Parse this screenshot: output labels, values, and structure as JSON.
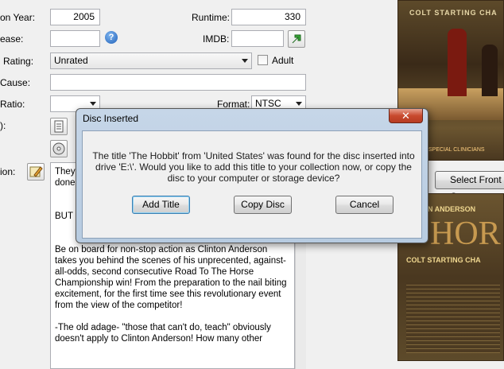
{
  "form": {
    "year_label": "on Year:",
    "year_value": "2005",
    "runtime_label": "Runtime:",
    "runtime_value": "330",
    "release_label": "ease:",
    "imdb_label": "IMDB:",
    "rating_label": "Rating:",
    "rating_value": "Unrated",
    "adult_label": "Adult",
    "cause_label": "Cause:",
    "ratio_label": "Ratio:",
    "format_label": "Format:",
    "format_value": "NTSC",
    "row_label_paren": "):",
    "description_label": "ion:"
  },
  "description": {
    "para1": "They",
    "para1b": "done",
    "para2": "BUT T",
    "para3": "Be on board for non-stop action as Clinton Anderson takes you behind the scenes of his unprecented, against-all-odds, second consecutive Road To The Horse Championship win! From the preparation to the nail biting excitement, for the first time see this revolutionary event from the view of the competitor!",
    "para4": "-The old adage- \"those that can't do, teach\" obviously doesn't apply to Clinton Anderson!  How many other"
  },
  "right_panel": {
    "select_front_label": "Select Front C",
    "cover_top_text": "COLT STARTING CHA",
    "cover_bottom_title": "ON ANDERSON",
    "cover_bottom_sub": "COLT STARTING CHA",
    "cover_tagline": "SPECIAL CLINICIANS"
  },
  "dialog": {
    "title": "Disc Inserted",
    "close_glyph": "✕",
    "message": "The title 'The Hobbit' from 'United States' was found for the disc inserted into drive 'E:\\'. Would you like to add this title to your collection now, or copy the disc to your computer or storage device?",
    "add_title_label": "Add Title",
    "copy_disc_label": "Copy Disc",
    "cancel_label": "Cancel"
  },
  "colors": {
    "dialog_frame": "#b7cbe0",
    "close_button": "#c84a2e",
    "imdb_button": "#3aa63a"
  },
  "icons": [
    "help-icon",
    "imdb-link-icon",
    "notes-icon",
    "disc-icon",
    "edit-icon",
    "close-icon",
    "dropdown-arrow-icon"
  ]
}
